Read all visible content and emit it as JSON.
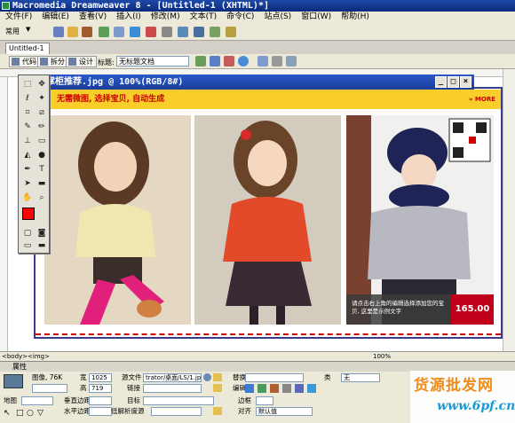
{
  "window": {
    "title": "Macromedia Dreamweaver 8 - [Untitled-1 (XHTML)*]"
  },
  "menu": [
    "文件(F)",
    "编辑(E)",
    "查看(V)",
    "插入(I)",
    "修改(M)",
    "文本(T)",
    "命令(C)",
    "站点(S)",
    "窗口(W)",
    "帮助(H)"
  ],
  "insert_bar": {
    "category": "常用"
  },
  "document": {
    "tab_label": "Untitled-1",
    "view_code": "代码",
    "view_split": "拆分",
    "view_design": "设计",
    "title_label": "标题:",
    "title_value": "无标题文档"
  },
  "image_window": {
    "title": "掌柜推荐.jpg @ 100%(RGB/8#)"
  },
  "banner": {
    "text": "无需微图, 选择宝贝, 自动生成",
    "more": "» MORE"
  },
  "photo3": {
    "caption": "请点击右上角的编辑选择添加您的宝贝, 这里是示例文字",
    "price": "165.00"
  },
  "statusbar": {
    "tag": "<body><img>",
    "zoom": "100%"
  },
  "properties": {
    "header": "属性",
    "image_label": "图像, 76K",
    "width_label": "宽",
    "width_value": "1025",
    "height_label": "高",
    "height_value": "719",
    "src_label": "源文件",
    "src_value": "trator/桌面/LS/1.jpg",
    "link_label": "链接",
    "alt_label": "替换",
    "edit_label": "编辑",
    "class_label": "类",
    "class_value": "无",
    "map_label": "地图",
    "vspace_label": "垂直边距",
    "hspace_label": "水平边距",
    "target_label": "目标",
    "lowsrc_label": "低解析度源",
    "border_label": "边框",
    "align_label": "对齐",
    "align_value": "默认值"
  },
  "watermark": {
    "line1": "货源批发网",
    "line2": "www.6pf.cn"
  },
  "colors": {
    "title_blue": "#0a2a7a",
    "banner_yellow": "#f9cd2a",
    "accent_red": "#c0001a"
  }
}
